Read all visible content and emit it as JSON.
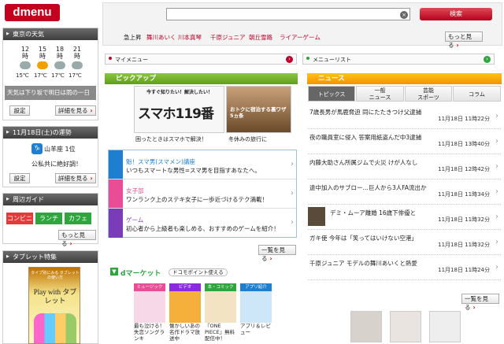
{
  "header": {
    "logo": "dmenu",
    "search_button": "検索",
    "trending_label": "急上昇",
    "trending": [
      "舞川あいく",
      "川本真琴",
      "千原ジュニア",
      "朝丘雪路",
      "ライアーゲーム"
    ],
    "more": "もっと見る"
  },
  "weather": {
    "title": "東京の天気",
    "hours": [
      "12\n時",
      "15\n時",
      "18\n時",
      "21\n時"
    ],
    "temps": [
      "15℃",
      "17℃",
      "17℃",
      "17℃"
    ],
    "summary": "天気は下り坂で明日は雨の一日",
    "set": "設定",
    "detail": "詳細を見る"
  },
  "fortune": {
    "title": "11月18日(土)の運勢",
    "sign": "山羊座 1位",
    "text": "公私共に絶好調！",
    "set": "設定",
    "detail": "詳細を見る"
  },
  "guide": {
    "title": "周辺ガイド",
    "items": [
      "コンビニ",
      "ランチ",
      "カフェ"
    ],
    "more": "もっと見る"
  },
  "tablet": {
    "title": "タブレット特集",
    "banner_top": "タイプ別にみる タブレットの使い方",
    "banner_main": "Play with タブレット"
  },
  "mymenu": "マイメニュー",
  "menulist": "メニューリスト",
  "pickup": {
    "title": "ピックアップ",
    "banner_caption": "困ったときはスマホで解決！",
    "banner2_caption": "冬休みの旅行に",
    "banner_text": "今すぐ知りたい！解決したい！",
    "banner_main": "スマホ119番",
    "banner2_text": "おトクに宿泊する裏ワザ5ヵ条",
    "items": [
      {
        "title": "魁！スマ男(スマメン)講座",
        "desc": "いつもスマートな男性=スマ男を目指すあなたへ。"
      },
      {
        "title": "女子部",
        "desc": "ワンランク上のステキ女子に一歩近づけるテク満載！"
      },
      {
        "title": "ゲーム",
        "desc": "初心者から上級者も楽しめる、おすすめのゲームを紹介！"
      }
    ],
    "list_button": "一覧を見る"
  },
  "market": {
    "title": "dマーケット",
    "points": "ドコモポイント使える",
    "cats": [
      "ミュージック",
      "ビデオ",
      "本・コミック",
      "アプリ紹介"
    ],
    "captions": [
      "最も泣ける！失恋ソングランキ",
      "懐かしいあの名作ドラマ放送中",
      "『ONE PIECE』無料配信中！",
      "アプリ＆レビュー"
    ]
  },
  "news": {
    "title": "ニュース",
    "tabs": [
      "トピックス",
      "一般\nニュース",
      "芸能\nスポーツ",
      "コラム"
    ],
    "items": [
      {
        "text": "7歳長男が馬鹿脅迫 同にたたきつけ父逮捕",
        "time": "11月18日 11時22分"
      },
      {
        "text": "夜の職員室に侵入 答案用紙盗んだ中3逮捕",
        "time": "11月18日 13時40分"
      },
      {
        "text": "内藤大助さん所属ジムで火災 けが人なし",
        "time": "11月18日 12時42分"
      },
      {
        "text": "途中加入のサブロー…巨人から3人FA流出か",
        "time": "11月18日 11時34分"
      },
      {
        "text": "デミ・ムーア離婚 16歳下俳優と",
        "time": "11月18日 11時32分"
      },
      {
        "text": "ガキ使 今年は「笑ってはいけない空港」",
        "time": "11月18日 11時32分"
      },
      {
        "text": "千原ジュニア モデルの舞川あいくと熱愛",
        "time": "11月18日 11時24分"
      }
    ],
    "list_button": "一覧を見る"
  }
}
